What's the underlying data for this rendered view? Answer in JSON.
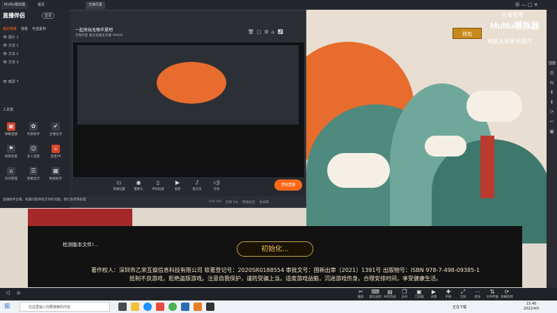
{
  "emulator": {
    "title": "MuMu模拟器",
    "home_tab": "首页",
    "game_tab": "无悔华夏",
    "brand_logo": "MuMu模拟器",
    "overlay_title": "主播使用",
    "overlay_subtitle": "电脑大屏更易操作",
    "gold_badge": "钱包"
  },
  "app": {
    "name": "直播伴侣",
    "login_label": "登录",
    "left_tabs": [
      "我的场景",
      "场景",
      "可选素材"
    ],
    "scenes": [
      "图片 1",
      "文本 1",
      "文本 2",
      "文本 3",
      "截屏 7"
    ],
    "tools_title": "工具箱",
    "tools": [
      {
        "label": "弹幕直播",
        "icon": "▣"
      },
      {
        "label": "背景助手",
        "icon": "✿"
      },
      {
        "label": "主播任务",
        "icon": "✔"
      },
      {
        "label": "视频连麦",
        "icon": "⚑"
      },
      {
        "label": "多人连麦",
        "icon": "☺"
      },
      {
        "label": "连麦PK",
        "icon": "⚔"
      },
      {
        "label": "房间管理",
        "icon": "⌂"
      },
      {
        "label": "弹幕显示",
        "icon": "☰"
      },
      {
        "label": "数据助手",
        "icon": "▦"
      }
    ],
    "notice": "直播助手主播，如遇问题请提交你的问题，我们会尽快处理",
    "room_title": "一起来玩无悔华夏吧",
    "room_sub1": "无悔华夏",
    "room_sub2": "最近直播未开播",
    "room_id": "99909",
    "bottom_controls": [
      "直播设置",
      "摄像头",
      "手机投屏",
      "美颜",
      "麦克风",
      "音效"
    ],
    "start_live": "开始直播",
    "stats": [
      "CPU 8%",
      "内存 0%",
      "网络延迟",
      "丢帧率"
    ]
  },
  "game": {
    "loading_text": "检测版本文件!...",
    "init_text": "初始化...",
    "copyright": "著作权人：深圳市乙宋互娱信息科技有限公司 软著登记号：2020SR0188554 审批文号：国新出审〔2021〕1391号    出版物号：ISBN 978-7-498-09385-1",
    "health_notice": "抵制不良游戏，拒绝盗版游戏。注意自我保护，谨防受骗上当。适度游戏益脑，沉迷游戏伤身。合理安排时间，享受健康生活。"
  },
  "emulator_toolbar": [
    "截屏",
    "操作录制",
    "共享目录",
    "多开",
    "工具箱",
    "录像",
    "手柄",
    "全屏",
    "更多",
    "文件传输",
    "屏幕旋转"
  ],
  "taskbar": {
    "search_placeholder": "在这里输入你要搜索的内容",
    "status_text": "正在下载",
    "time": "15:40",
    "date": "2022/4/5"
  }
}
